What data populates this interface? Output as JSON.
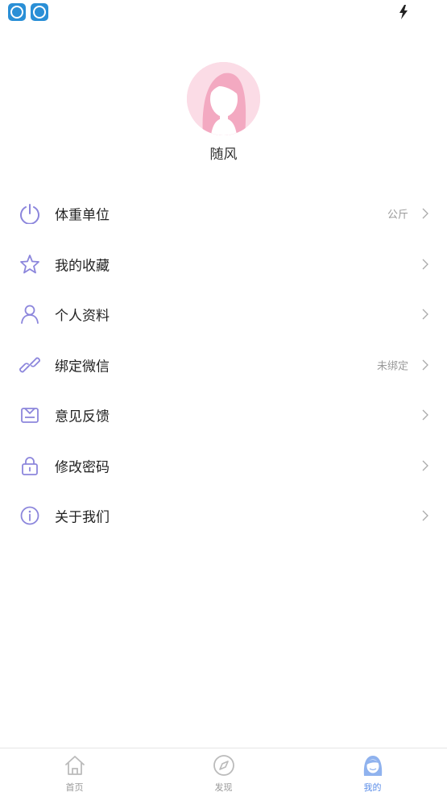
{
  "status_bar": {
    "app_icon_1": "app-icon",
    "app_icon_2": "app-icon",
    "charging": "lightning-icon"
  },
  "profile": {
    "username": "随风"
  },
  "menu": [
    {
      "label": "体重单位",
      "value": "公斤",
      "icon": "timer-icon"
    },
    {
      "label": "我的收藏",
      "value": "",
      "icon": "star-icon"
    },
    {
      "label": "个人资料",
      "value": "",
      "icon": "user-icon"
    },
    {
      "label": "绑定微信",
      "value": "未绑定",
      "icon": "link-icon"
    },
    {
      "label": "意见反馈",
      "value": "",
      "icon": "mail-icon"
    },
    {
      "label": "修改密码",
      "value": "",
      "icon": "lock-icon"
    },
    {
      "label": "关于我们",
      "value": "",
      "icon": "info-icon"
    }
  ],
  "chevron_glyph": ">",
  "tabs": [
    {
      "label": "首页",
      "icon": "home-icon",
      "active": false
    },
    {
      "label": "发现",
      "icon": "compass-icon",
      "active": false
    },
    {
      "label": "我的",
      "icon": "profile-icon",
      "active": true
    }
  ],
  "colors": {
    "accent": "#8c86dc",
    "tab_active": "#5b8de8",
    "avatar_bg": "#f9d3df"
  }
}
